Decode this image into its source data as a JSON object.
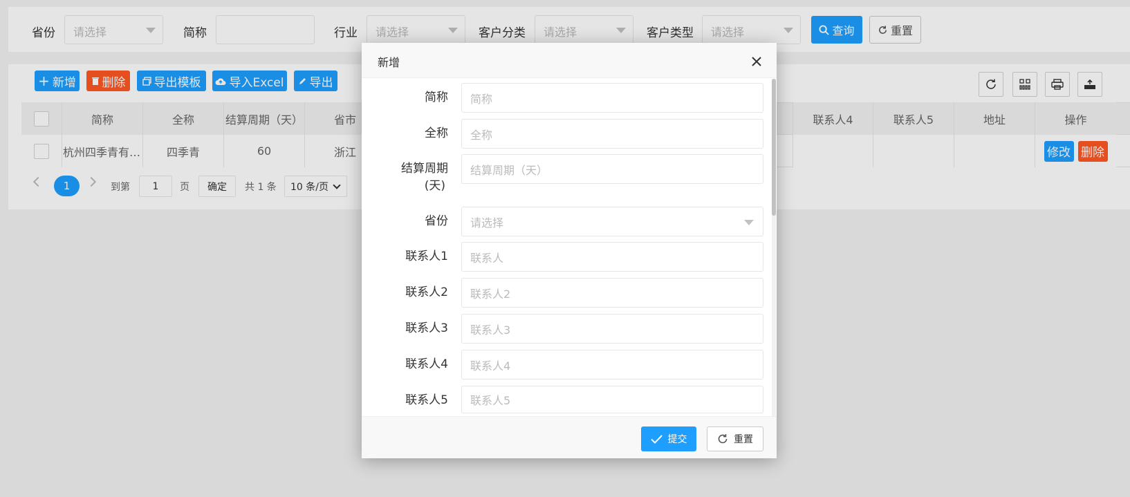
{
  "search": {
    "province_label": "省份",
    "province_placeholder": "请选择",
    "short_label": "简称",
    "industry_label": "行业",
    "industry_placeholder": "请选择",
    "category_label": "客户分类",
    "category_placeholder": "请选择",
    "type_label": "客户类型",
    "type_placeholder": "请选择",
    "query_label": "查询",
    "reset_label": "重置"
  },
  "toolbar": {
    "add_label": "新增",
    "delete_label": "删除",
    "export_template_label": "导出模板",
    "import_excel_label": "导入Excel",
    "export_label": "导出"
  },
  "table": {
    "headers": {
      "short": "简称",
      "full": "全称",
      "period": "结算周期（天）",
      "province": "省市",
      "contact4": "联系人4",
      "contact5": "联系人5",
      "address": "地址",
      "action": "操作"
    },
    "rows": [
      {
        "short": "杭州四季青有…",
        "full": "四季青",
        "period": "60",
        "province": "浙江",
        "contact4": "",
        "contact5": "",
        "address": "",
        "edit_label": "修改",
        "delete_label": "删除"
      }
    ]
  },
  "pagination": {
    "current_page": "1",
    "goto_label": "到第",
    "goto_value": "1",
    "page_unit": "页",
    "confirm_label": "确定",
    "total_label": "共 1 条",
    "page_size": "10 条/页"
  },
  "dialog": {
    "title": "新增",
    "fields": {
      "short": {
        "label": "简称",
        "placeholder": "简称"
      },
      "full": {
        "label": "全称",
        "placeholder": "全称"
      },
      "period": {
        "label_line1": "结算周期",
        "label_line2": "(天)",
        "placeholder": "结算周期（天）"
      },
      "province": {
        "label": "省份",
        "placeholder": "请选择"
      },
      "contact1": {
        "label": "联系人1",
        "placeholder": "联系人"
      },
      "contact2": {
        "label": "联系人2",
        "placeholder": "联系人2"
      },
      "contact3": {
        "label": "联系人3",
        "placeholder": "联系人3"
      },
      "contact4": {
        "label": "联系人4",
        "placeholder": "联系人4"
      },
      "contact5": {
        "label": "联系人5",
        "placeholder": "联系人5"
      }
    },
    "submit_label": "提交",
    "reset_label": "重置"
  },
  "colors": {
    "primary": "#1e9fff",
    "danger": "#ff5722"
  }
}
